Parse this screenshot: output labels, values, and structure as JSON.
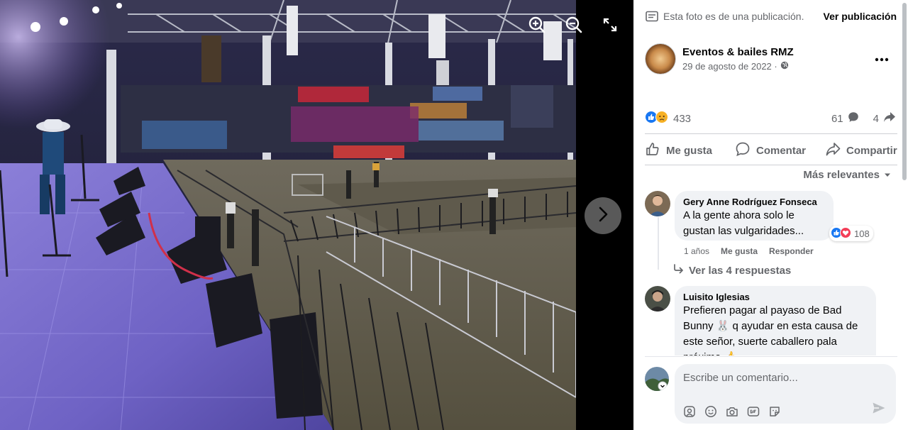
{
  "viewer": {
    "icons": {
      "zoom_in": "zoom-in-icon",
      "zoom_out": "zoom-out-icon",
      "fullscreen": "fullscreen-icon",
      "next": "chevron-right-icon"
    }
  },
  "panel": {
    "notice": "Esta foto es de una publicación.",
    "notice_link": "Ver publicación",
    "author": {
      "name": "Eventos & bailes RMZ",
      "date": "29 de agosto de 2022 ·",
      "privacy_icon": "globe-icon"
    },
    "reactions": {
      "types": [
        "like",
        "sad"
      ],
      "count": "433",
      "comments": "61",
      "shares": "4"
    },
    "actions": {
      "like": "Me gusta",
      "comment": "Comentar",
      "share": "Compartir"
    },
    "sort_label": "Más relevantes",
    "comments": [
      {
        "name": "Gery Anne Rodríguez Fonseca",
        "text_line1": "A la gente ahora solo le",
        "text_line2": "gustan las vulgaridades...",
        "reactions_count": "108",
        "time": "1 años",
        "like_label": "Me gusta",
        "reply_label": "Responder",
        "replies_link": "Ver las 4 respuestas"
      },
      {
        "name": "Luisito Iglesias",
        "text_line1": "Prefieren pagar al payaso de Bad",
        "text_line2": "Bunny 🐰 q ayudar en esta causa de",
        "text_line3": "este señor, suerte caballero pala",
        "text_line4": "próxima 👍"
      }
    ],
    "composer": {
      "placeholder": "Escribe un comentario..."
    }
  },
  "colors": {
    "like_blue": "#1877f2",
    "love_red": "#f33e58",
    "sad_yellow": "#f7b125",
    "secondary_text": "#65676b",
    "bubble_bg": "#f0f2f5"
  }
}
